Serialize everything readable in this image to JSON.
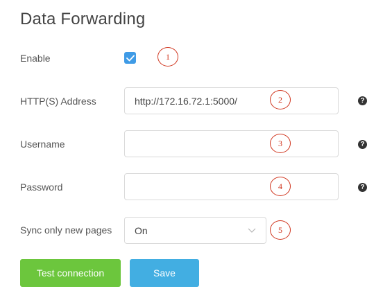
{
  "page": {
    "title": "Data Forwarding"
  },
  "form": {
    "enable": {
      "label": "Enable",
      "checked": true
    },
    "address": {
      "label": "HTTP(S) Address",
      "value": "http://172.16.72.1:5000/",
      "help_icon": "question-circle-icon"
    },
    "username": {
      "label": "Username",
      "value": "",
      "help_icon": "question-circle-icon"
    },
    "password": {
      "label": "Password",
      "value": "",
      "help_icon": "question-circle-icon"
    },
    "sync_only_new_pages": {
      "label": "Sync only new pages",
      "selected": "On",
      "icon": "chevron-down-icon"
    }
  },
  "callouts": [
    "1",
    "2",
    "3",
    "4",
    "5"
  ],
  "buttons": {
    "test_connection": "Test connection",
    "save": "Save"
  },
  "colors": {
    "checkbox": "#3f9be6",
    "test_button": "#6cc63d",
    "save_button": "#42aee2",
    "callout": "#d0361f"
  }
}
